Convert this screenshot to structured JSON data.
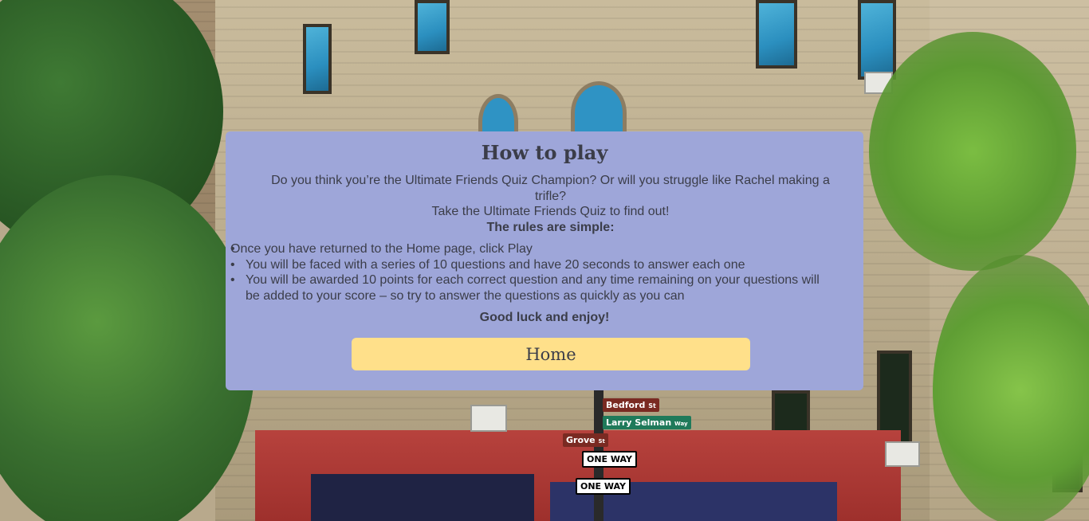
{
  "card": {
    "title": "How to play",
    "intro_line1": "Do you think you’re the Ultimate Friends Quiz Champion? Or will you struggle like Rachel making a trifle?",
    "intro_line2": "Take the Ultimate Friends Quiz to find out!",
    "rules_heading": "The rules are simple:",
    "rules": [
      "Once you have returned to the Home page, click Play",
      "You will be faced with a series of 10 questions and have 20 seconds to answer each one",
      "You will be awarded 10 points for each correct question and any time remaining on your questions will be added to your score – so try to answer the questions as quickly as you can"
    ],
    "closing": "Good luck and enjoy!",
    "home_button": "Home"
  },
  "background": {
    "street_signs": {
      "bedford": "Bedford",
      "bedford_suffix": "St",
      "larry": "Larry Selman",
      "larry_suffix": "Way",
      "grove": "Grove",
      "grove_suffix": "St",
      "one_way": "ONE WAY"
    }
  },
  "colors": {
    "card_bg": "#9ea6d9",
    "button_bg": "#ffe08a",
    "text": "#3b3d49"
  }
}
